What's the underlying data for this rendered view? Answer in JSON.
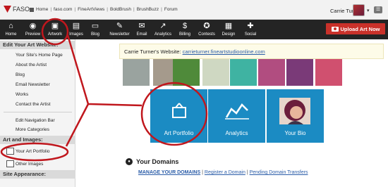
{
  "topbar": {
    "logo_text": "FASO",
    "links": [
      "Home",
      "faso.com",
      "FineArtViews",
      "BoldBrush",
      "BrushBuzz",
      "Forum"
    ],
    "user_name": "Carrie Turner"
  },
  "nav": {
    "items": [
      {
        "label": "Home",
        "icon": "home-icon"
      },
      {
        "label": "Preview",
        "icon": "eye-icon"
      },
      {
        "label": "Artwork",
        "icon": "easel-icon"
      },
      {
        "label": "Images",
        "icon": "images-icon"
      },
      {
        "label": "Blog",
        "icon": "blog-icon"
      },
      {
        "label": "Newsletter",
        "icon": "quill-icon"
      },
      {
        "label": "Email",
        "icon": "envelope-icon"
      },
      {
        "label": "Analytics",
        "icon": "chart-icon"
      },
      {
        "label": "Billing",
        "icon": "dollar-icon"
      },
      {
        "label": "Contests",
        "icon": "ribbon-icon"
      },
      {
        "label": "Design",
        "icon": "design-icon"
      },
      {
        "label": "Social",
        "icon": "social-icon"
      }
    ],
    "upload_label": "Upload Art Now"
  },
  "sidebar": {
    "section1": "Edit Your Art Website:",
    "items1": [
      "Your Site's Home Page",
      "About the Artist",
      "Blog",
      "Email Newsletter",
      "Works",
      "Contact the Artist"
    ],
    "items1b": [
      "Edit Navigation Bar",
      "More Categories"
    ],
    "section2": "Art and Images:",
    "items2": [
      "Your Art Portfolio",
      "Other Images"
    ],
    "section3": "Site Appearance:"
  },
  "main": {
    "site_label": "Carrie Turner's Website:",
    "site_url": "carrieturner.fineartstudioonline.com",
    "thumbnail_colors": [
      "#9aa39f",
      "#a59a8c",
      "#4f8a3a",
      "#cfd8c2",
      "#3fb3a2",
      "#b14d80",
      "#7a3a78",
      "#d0506f"
    ],
    "tiles": [
      {
        "label": "Art Portfolio",
        "icon": "easel-icon",
        "color": "#1b8bc3"
      },
      {
        "label": "Analytics",
        "icon": "chart-icon",
        "color": "#1b8bc3"
      },
      {
        "label": "Your Bio",
        "icon": "portrait-icon",
        "color": "#1b8bc3"
      }
    ],
    "domains": {
      "title": "Your Domains",
      "manage": "MANAGE YOUR DOMAINS",
      "register": "Register a Domain",
      "pending": "Pending Domain Transfers"
    }
  },
  "colors": {
    "accent": "#c0171d",
    "nav_bg": "#242424",
    "tile_blue": "#1b8bc3",
    "link": "#2a5ca8"
  }
}
